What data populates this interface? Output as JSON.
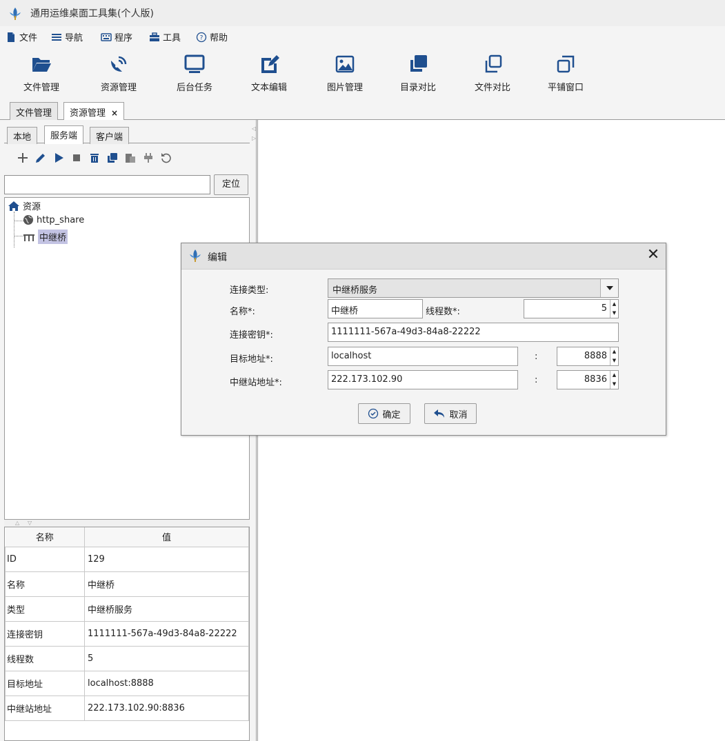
{
  "window": {
    "title": "通用运维桌面工具集(个人版)"
  },
  "menu": {
    "file": "文件",
    "nav": "导航",
    "program": "程序",
    "tools": "工具",
    "help": "帮助"
  },
  "toolbar": {
    "file_mgr": "文件管理",
    "res_mgr": "资源管理",
    "bg_tasks": "后台任务",
    "text_edit": "文本编辑",
    "img_mgr": "图片管理",
    "dir_compare": "目录对比",
    "file_compare": "文件对比",
    "tile_windows": "平铺窗口"
  },
  "main_tabs": {
    "file_mgr": "文件管理",
    "res_mgr": "资源管理",
    "close": "×"
  },
  "sub_tabs": {
    "local": "本地",
    "server": "服务端",
    "client": "客户端"
  },
  "locate": {
    "input_value": "",
    "button": "定位"
  },
  "tree": {
    "root": "资源",
    "children": [
      "http_share",
      "中继桥"
    ]
  },
  "props": {
    "headers": [
      "名称",
      "值"
    ],
    "rows": [
      {
        "key": "ID",
        "value": "129"
      },
      {
        "key": "名称",
        "value": "中继桥"
      },
      {
        "key": "类型",
        "value": "中继桥服务"
      },
      {
        "key": "连接密钥",
        "value": "1111111-567a-49d3-84a8-22222"
      },
      {
        "key": "线程数",
        "value": "5"
      },
      {
        "key": "目标地址",
        "value": "localhost:8888"
      },
      {
        "key": "中继站地址",
        "value": "222.173.102.90:8836"
      }
    ]
  },
  "dialog": {
    "title": "编辑",
    "close": "✕",
    "conn_type_label": "连接类型:",
    "conn_type_value": "中继桥服务",
    "name_label": "名称*:",
    "name_value": "中继桥",
    "threads_label": "线程数*:",
    "threads_value": "5",
    "key_label": "连接密钥*:",
    "key_value": "1111111-567a-49d3-84a8-22222",
    "target_label": "目标地址*:",
    "target_host": "localhost",
    "target_port": "8888",
    "relay_label": "中继站地址*:",
    "relay_host": "222.173.102.90",
    "relay_port": "8836",
    "colon": ":",
    "ok": "确定",
    "cancel": "取消"
  },
  "colors": {
    "icon_blue": "#1f4f8f",
    "selection": "#c3c3e3",
    "panel_bg": "#f4f4f4"
  }
}
